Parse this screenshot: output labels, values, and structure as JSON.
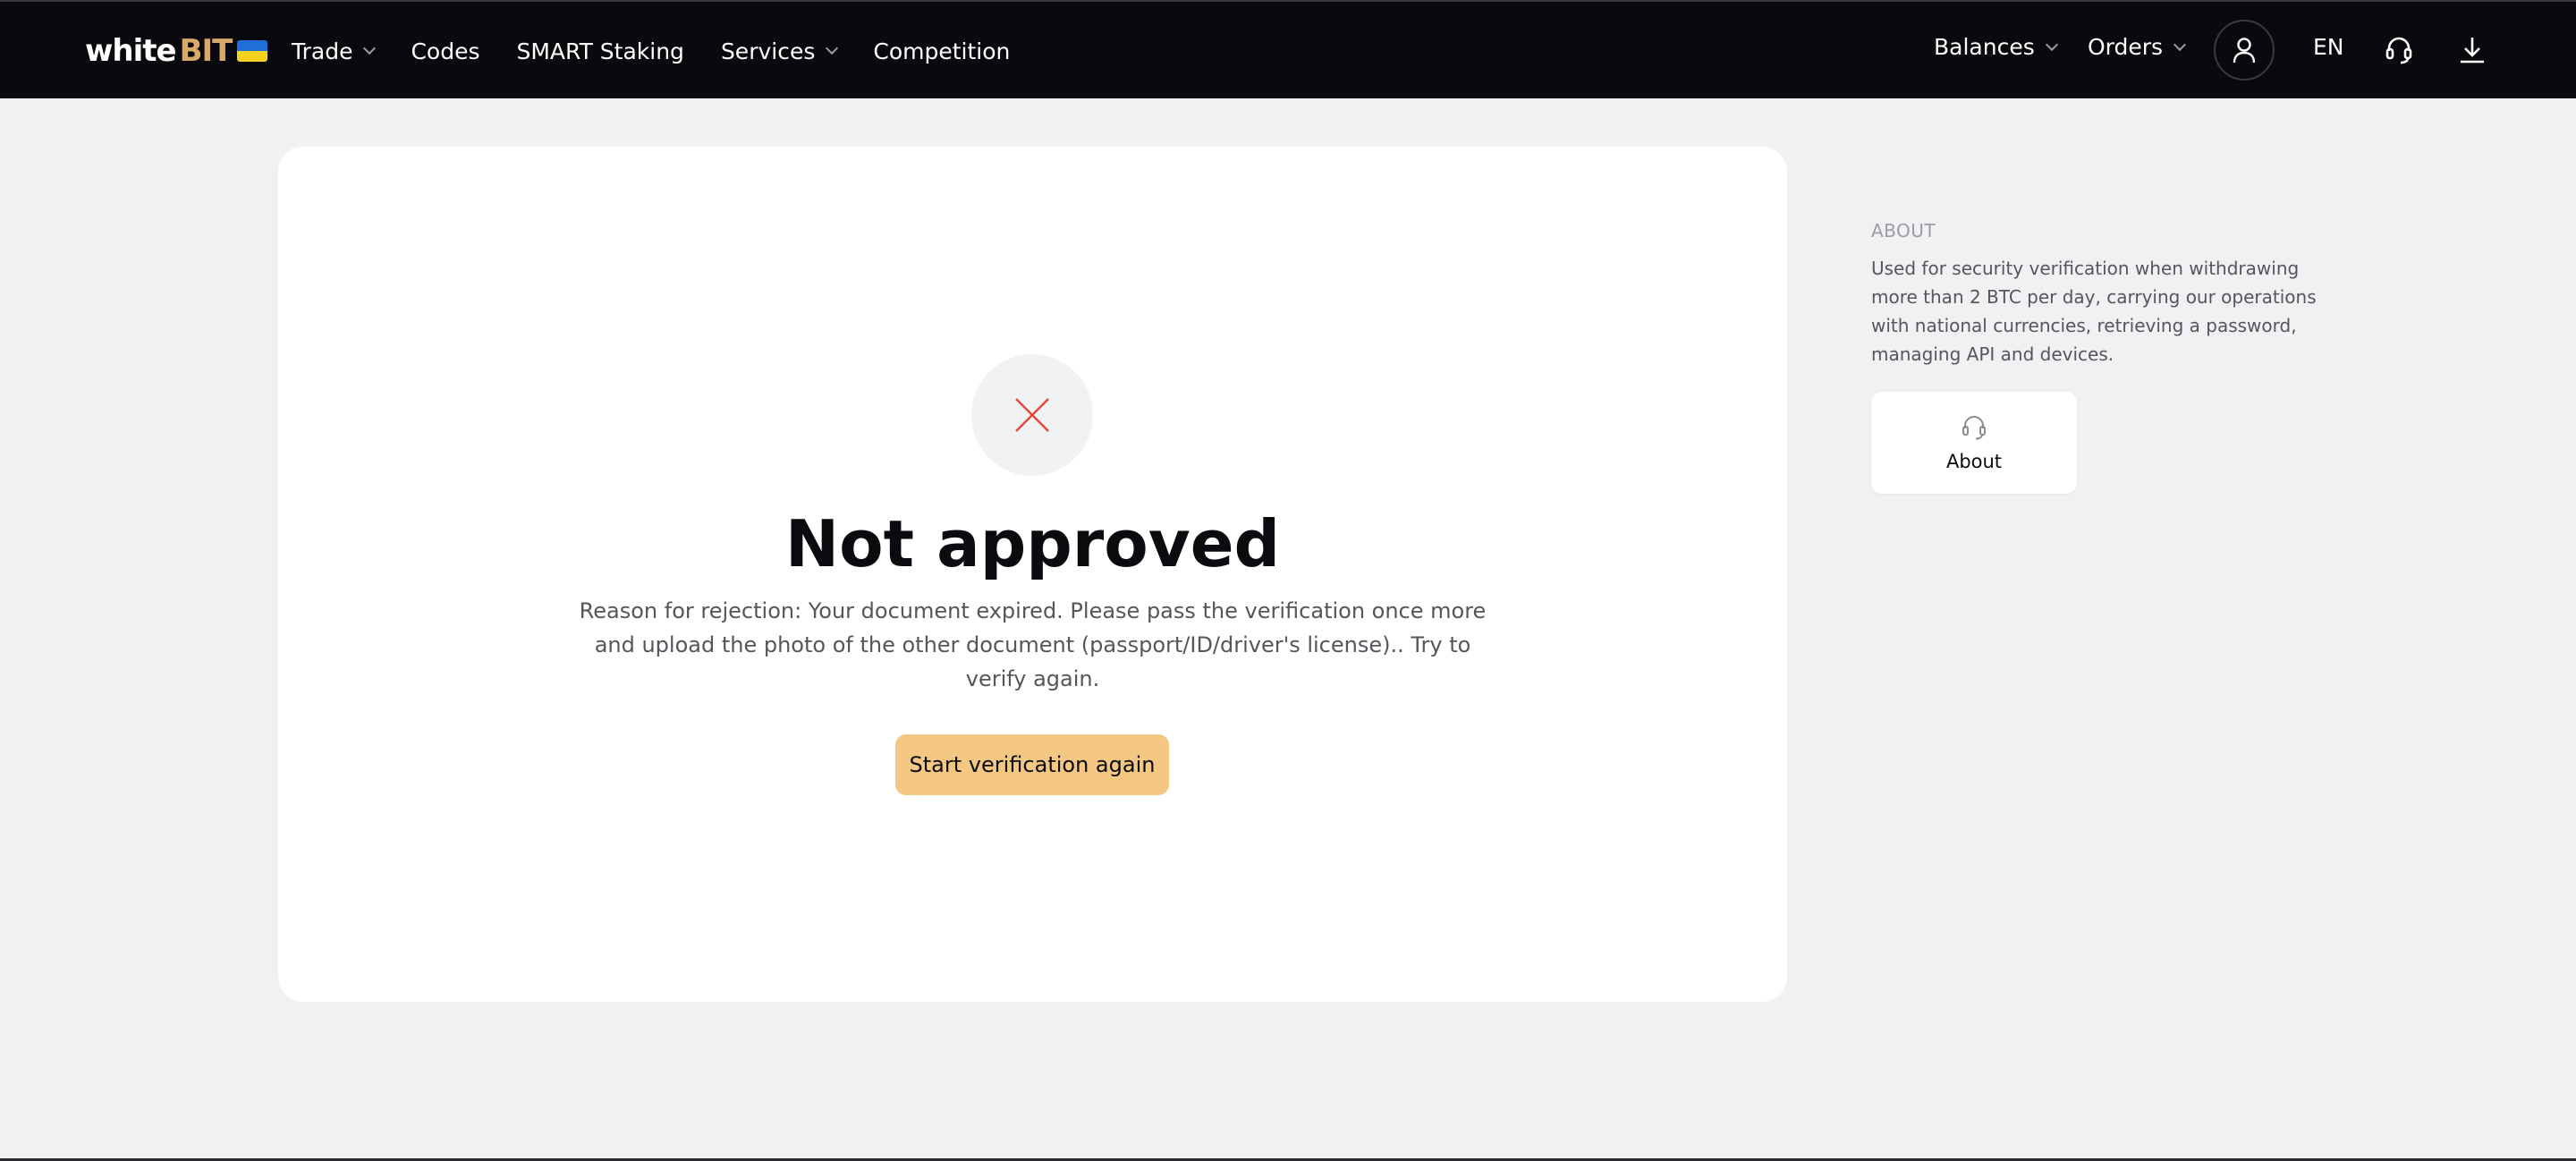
{
  "brand": {
    "name_white": "white",
    "name_accent": "BIT",
    "accent_color": "#d8a968",
    "flag_colors": [
      "#1f6fd6",
      "#f4d21f"
    ]
  },
  "nav": {
    "items": [
      {
        "label": "Trade",
        "has_dropdown": true
      },
      {
        "label": "Codes",
        "has_dropdown": false
      },
      {
        "label": "SMART Staking",
        "has_dropdown": false
      },
      {
        "label": "Services",
        "has_dropdown": true
      },
      {
        "label": "Competition",
        "has_dropdown": false
      }
    ],
    "right": {
      "balances_label": "Balances",
      "orders_label": "Orders",
      "language": "EN",
      "icons": [
        "user-icon",
        "headset-icon",
        "download-icon"
      ]
    }
  },
  "verification": {
    "status_icon": "close-icon",
    "status_icon_color": "#e8473b",
    "title": "Not approved",
    "reason": "Reason for rejection: Your document expired. Please pass the verification once more and upload the photo of the other document (passport/ID/driver's license).. Try to verify again.",
    "cta_label": "Start verification again",
    "cta_color": "#f4c883"
  },
  "about": {
    "section_label": "ABOUT",
    "description": "Used for security verification when withdrawing more than 2 BTC per day, carrying our operations with national currencies, retrieving a password, managing API and devices.",
    "card_label": "About",
    "card_icon": "headset-icon"
  }
}
